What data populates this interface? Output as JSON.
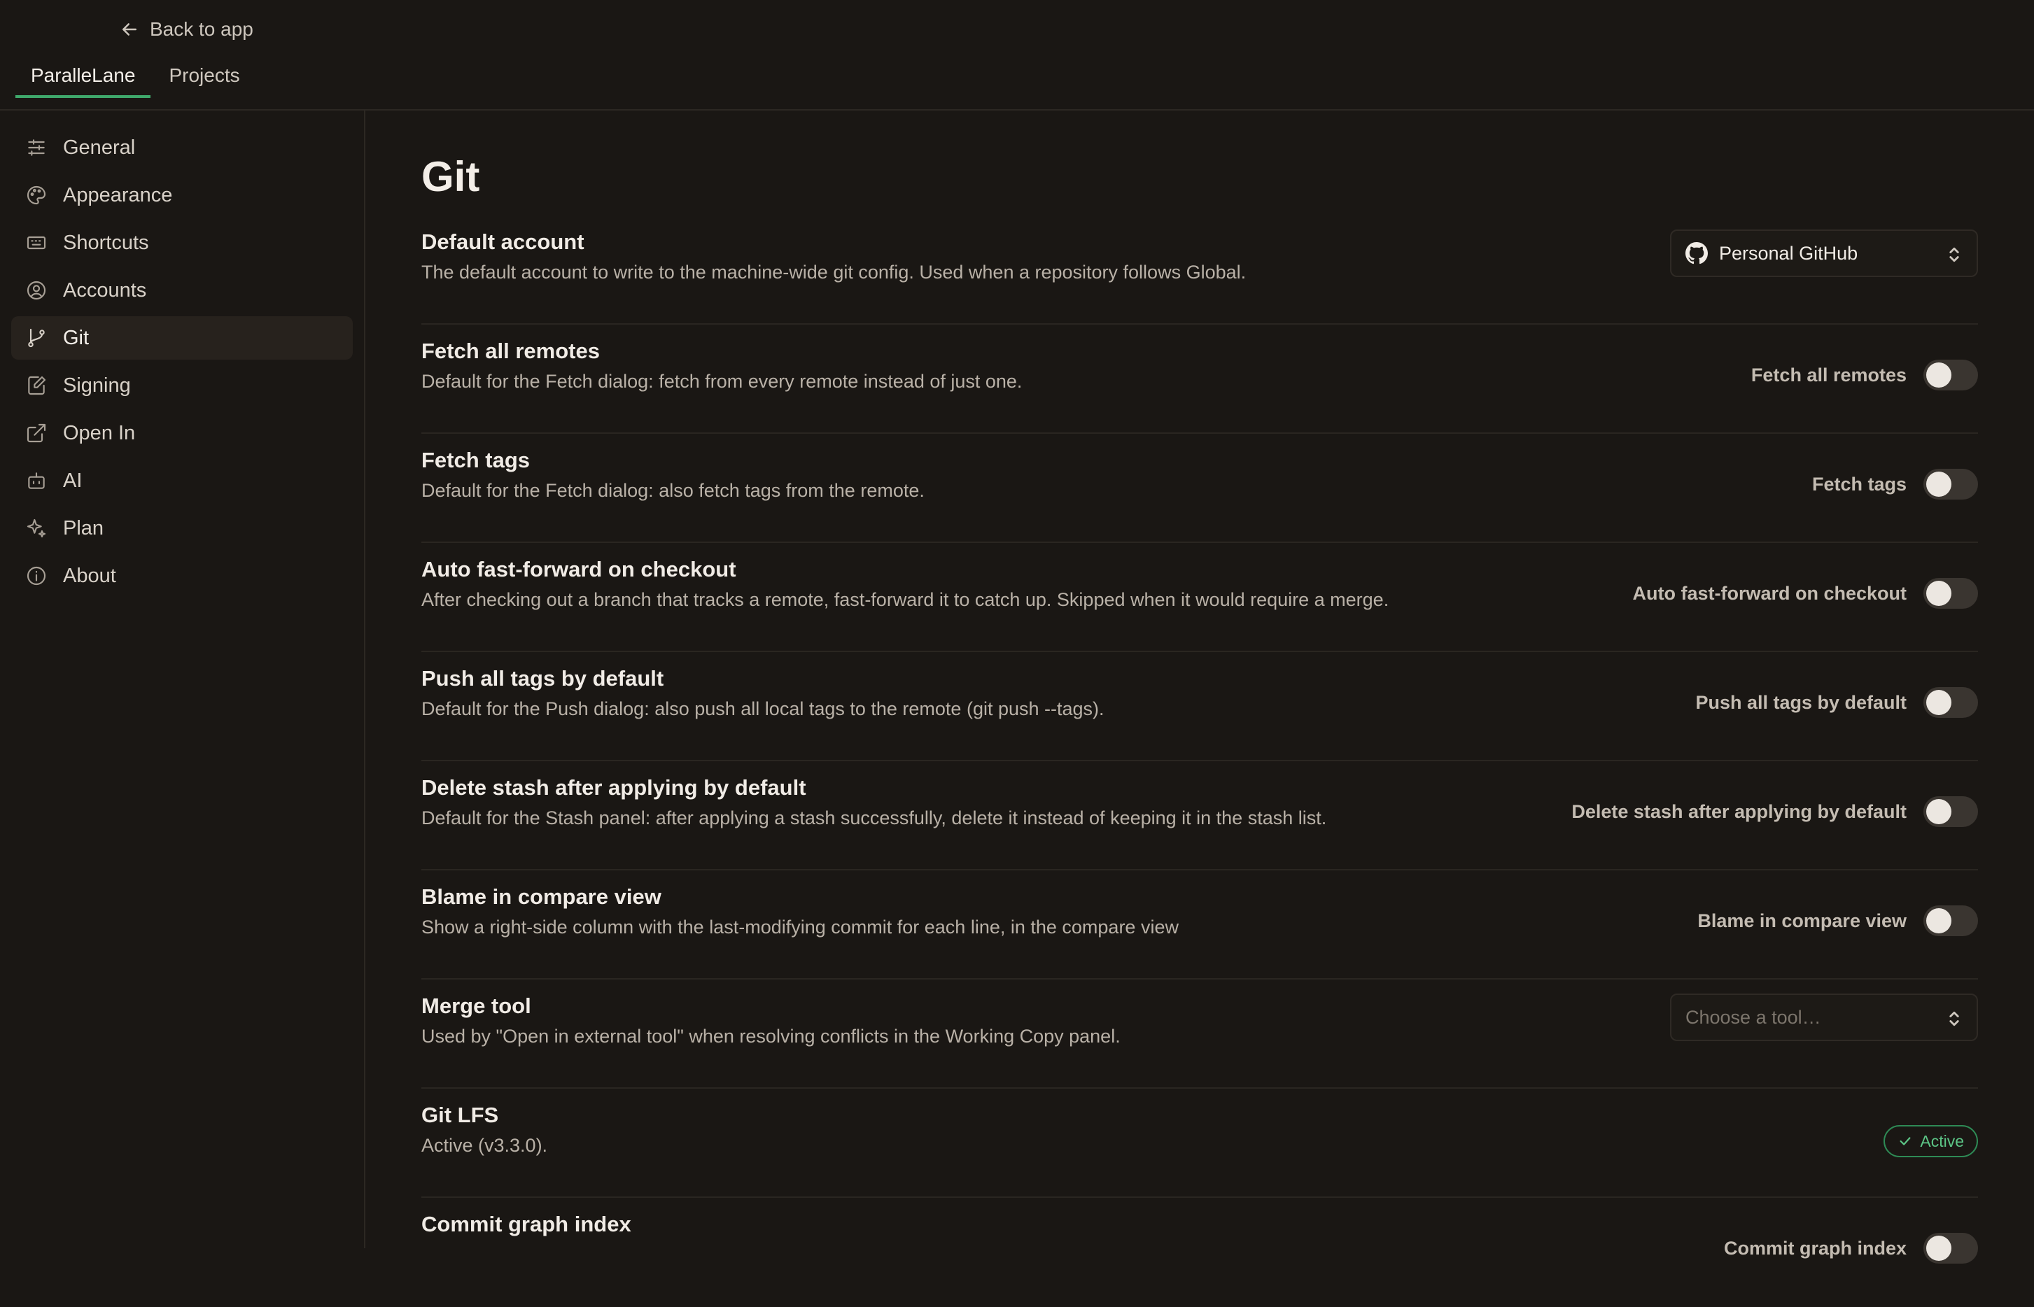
{
  "header": {
    "back_label": "Back to app",
    "tabs": [
      {
        "label": "ParalleLane",
        "active": true
      },
      {
        "label": "Projects",
        "active": false
      }
    ]
  },
  "sidebar": {
    "items": [
      {
        "label": "General",
        "icon": "sliders-icon"
      },
      {
        "label": "Appearance",
        "icon": "palette-icon"
      },
      {
        "label": "Shortcuts",
        "icon": "keyboard-icon"
      },
      {
        "label": "Accounts",
        "icon": "user-circle-icon"
      },
      {
        "label": "Git",
        "icon": "git-branch-icon",
        "active": true
      },
      {
        "label": "Signing",
        "icon": "signature-icon"
      },
      {
        "label": "Open In",
        "icon": "external-link-icon"
      },
      {
        "label": "AI",
        "icon": "bot-icon"
      },
      {
        "label": "Plan",
        "icon": "sparkles-icon"
      },
      {
        "label": "About",
        "icon": "info-icon"
      }
    ]
  },
  "main": {
    "title": "Git",
    "settings": [
      {
        "title": "Default account",
        "description": "The default account to write to the machine-wide git config. Used when a repository follows Global.",
        "control": "select",
        "value": "Personal GitHub",
        "icon": "github-icon"
      },
      {
        "title": "Fetch all remotes",
        "description": "Default for the Fetch dialog: fetch from every remote instead of just one.",
        "control": "toggle",
        "toggle_label": "Fetch all remotes",
        "checked": false
      },
      {
        "title": "Fetch tags",
        "description": "Default for the Fetch dialog: also fetch tags from the remote.",
        "control": "toggle",
        "toggle_label": "Fetch tags",
        "checked": false
      },
      {
        "title": "Auto fast-forward on checkout",
        "description": "After checking out a branch that tracks a remote, fast-forward it to catch up. Skipped when it would require a merge.",
        "control": "toggle",
        "toggle_label": "Auto fast-forward on checkout",
        "checked": false
      },
      {
        "title": "Push all tags by default",
        "description": "Default for the Push dialog: also push all local tags to the remote (git push --tags).",
        "control": "toggle",
        "toggle_label": "Push all tags by default",
        "checked": false
      },
      {
        "title": "Delete stash after applying by default",
        "description": "Default for the Stash panel: after applying a stash successfully, delete it instead of keeping it in the stash list.",
        "control": "toggle",
        "toggle_label": "Delete stash after applying by default",
        "checked": false
      },
      {
        "title": "Blame in compare view",
        "description": "Show a right-side column with the last-modifying commit for each line, in the compare view",
        "control": "toggle",
        "toggle_label": "Blame in compare view",
        "checked": false
      },
      {
        "title": "Merge tool",
        "description": "Used by \"Open in external tool\" when resolving conflicts in the Working Copy panel.",
        "control": "select",
        "placeholder": "Choose a tool…"
      },
      {
        "title": "Git LFS",
        "description": "Active (v3.3.0).",
        "control": "badge",
        "badge": "Active"
      },
      {
        "title": "Commit graph index",
        "description": "",
        "control": "toggle",
        "toggle_label": "Commit graph index",
        "checked": false
      }
    ]
  },
  "colors": {
    "accent": "#3fa86b",
    "badge": "#5cc586",
    "background": "#1a1714"
  }
}
